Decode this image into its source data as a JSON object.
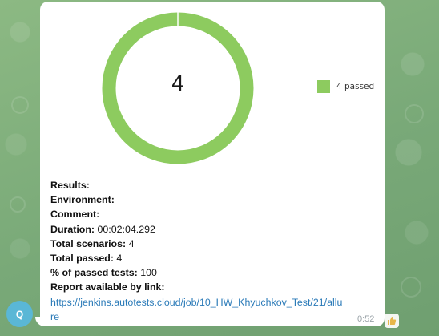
{
  "chart_data": {
    "type": "pie",
    "categories": [
      "passed"
    ],
    "values": [
      4
    ],
    "center_label": "4",
    "legend": [
      "4 passed"
    ],
    "colors": [
      "#8dcb5f"
    ],
    "legend_placement": "right"
  },
  "report": {
    "results_label": "Results:",
    "environment_label": "Environment:",
    "comment_label": "Comment:",
    "duration_label": "Duration:",
    "duration_value": "00:02:04.292",
    "total_scenarios_label": "Total scenarios:",
    "total_scenarios_value": "4",
    "total_passed_label": "Total passed:",
    "total_passed_value": "4",
    "passed_percent_label": "% of passed tests:",
    "passed_percent_value": "100",
    "report_link_label": "Report available by link:",
    "report_link_part1": "https://jenkins.autotests.cloud/job/10_HW_Khyuchkov_Test/21/allu",
    "report_link_part2": "re"
  },
  "message": {
    "time": "0:52",
    "sender_initial": "Q",
    "reaction_icon": "thumbs-up-icon"
  }
}
